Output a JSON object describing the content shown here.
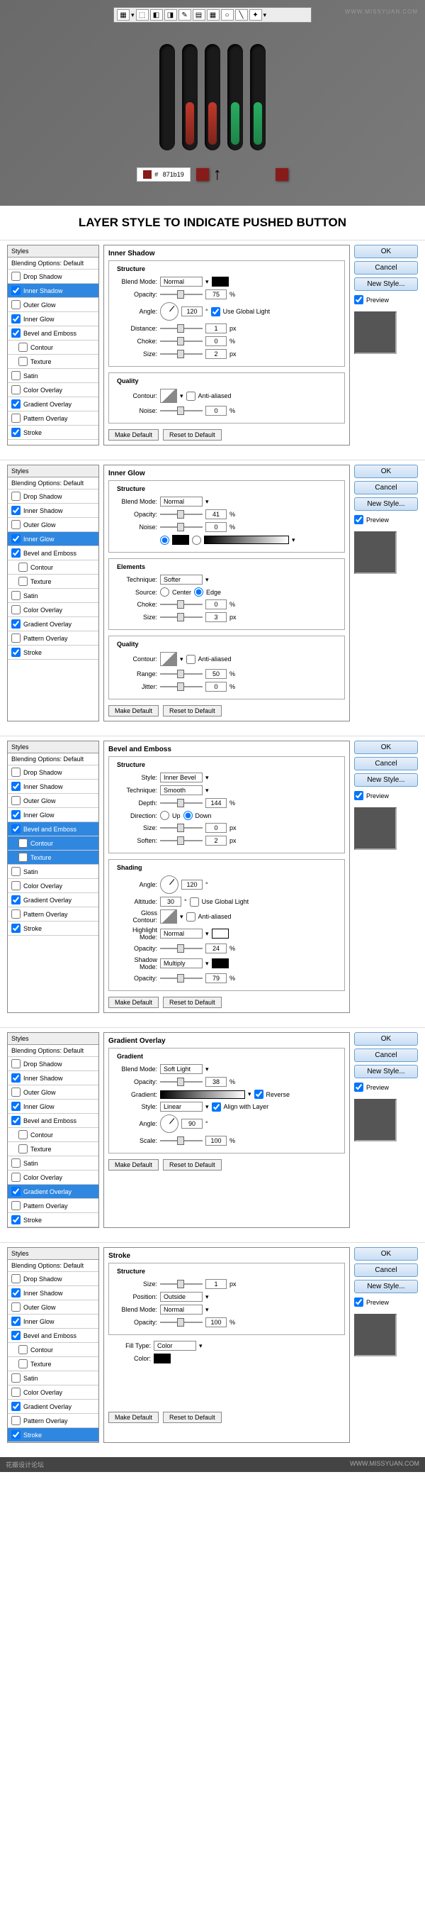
{
  "watermark": "WWW.MISSYUAN.COM",
  "hex": "871b19",
  "title": "LAYER STYLE TO INDICATE PUSHED BUTTON",
  "buttons": {
    "ok": "OK",
    "cancel": "Cancel",
    "newstyle": "New Style...",
    "preview": "Preview",
    "makedef": "Make Default",
    "reset": "Reset to Default"
  },
  "sidebar": {
    "head": "Styles",
    "blend": "Blending Options: Default",
    "items": [
      "Drop Shadow",
      "Inner Shadow",
      "Outer Glow",
      "Inner Glow",
      "Bevel and Emboss",
      "Contour",
      "Texture",
      "Satin",
      "Color Overlay",
      "Gradient Overlay",
      "Pattern Overlay",
      "Stroke"
    ]
  },
  "labels": {
    "structure": "Structure",
    "quality": "Quality",
    "elements": "Elements",
    "shading": "Shading",
    "gradient": "Gradient",
    "blendmode": "Blend Mode:",
    "opacity": "Opacity:",
    "angle": "Angle:",
    "distance": "Distance:",
    "choke": "Choke:",
    "size": "Size:",
    "contour": "Contour:",
    "noise": "Noise:",
    "aa": "Anti-aliased",
    "ugl": "Use Global Light",
    "technique": "Technique:",
    "source": "Source:",
    "center": "Center",
    "edge": "Edge",
    "range": "Range:",
    "jitter": "Jitter:",
    "style": "Style:",
    "depth": "Depth:",
    "direction": "Direction:",
    "up": "Up",
    "down": "Down",
    "soften": "Soften:",
    "altitude": "Altitude:",
    "gloss": "Gloss Contour:",
    "highlight": "Highlight Mode:",
    "shadow": "Shadow Mode:",
    "gradfield": "Gradient:",
    "reverse": "Reverse",
    "align": "Align with Layer",
    "scale": "Scale:",
    "position": "Position:",
    "filltype": "Fill Type:",
    "color": "Color:"
  },
  "d1": {
    "title": "Inner Shadow",
    "mode": "Normal",
    "opacity": "75",
    "angle": "120",
    "distance": "1",
    "choke": "0",
    "size": "2",
    "noise": "0"
  },
  "d2": {
    "title": "Inner Glow",
    "mode": "Normal",
    "opacity": "41",
    "noise": "0",
    "tech": "Softer",
    "choke": "0",
    "size": "3",
    "range": "50",
    "jitter": "0"
  },
  "d3": {
    "title": "Bevel and Emboss",
    "style": "Inner Bevel",
    "tech": "Smooth",
    "depth": "144",
    "size": "0",
    "soften": "2",
    "angle": "120",
    "altitude": "30",
    "hmode": "Normal",
    "hop": "24",
    "smode": "Multiply",
    "sop": "79"
  },
  "d4": {
    "title": "Gradient Overlay",
    "mode": "Soft Light",
    "opacity": "38",
    "style": "Linear",
    "angle": "90",
    "scale": "100"
  },
  "d5": {
    "title": "Stroke",
    "size": "1",
    "position": "Outside",
    "mode": "Normal",
    "opacity": "100",
    "fill": "Color"
  },
  "footer": {
    "l": "花瓣设计论坛",
    "r": "WWW.MISSYUAN.COM"
  }
}
